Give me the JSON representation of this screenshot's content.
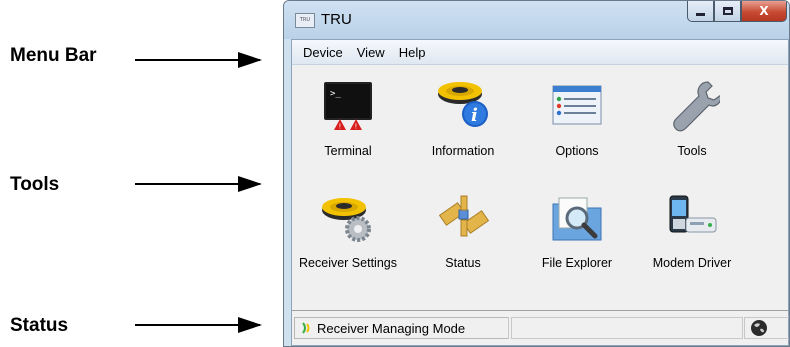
{
  "callouts": {
    "menu_bar": "Menu Bar",
    "tools": "Tools",
    "status": "Status"
  },
  "window": {
    "title": "TRU",
    "app_icon_text": "TRU",
    "caption": {
      "minimize": "",
      "maximize": "",
      "close": "X"
    }
  },
  "menu": [
    "Device",
    "View",
    "Help"
  ],
  "tools": [
    {
      "label": "Terminal",
      "icon": "terminal-icon"
    },
    {
      "label": "Information",
      "icon": "information-icon"
    },
    {
      "label": "Options",
      "icon": "options-icon"
    },
    {
      "label": "Tools",
      "icon": "wrench-icon"
    },
    {
      "label": "Receiver Settings",
      "icon": "receiver-settings-icon"
    },
    {
      "label": "Status",
      "icon": "status-icon"
    },
    {
      "label": "File Explorer",
      "icon": "file-explorer-icon"
    },
    {
      "label": "Modem Driver",
      "icon": "modem-driver-icon"
    }
  ],
  "status": {
    "mode_text": "Receiver Managing Mode",
    "mode_icon": "receiver-signal-icon",
    "connection_icon": "globe-icon"
  },
  "colors": {
    "accent_yellow": "#f2c200",
    "close_red": "#c84a33",
    "window_frame": "#cfe0ee"
  }
}
